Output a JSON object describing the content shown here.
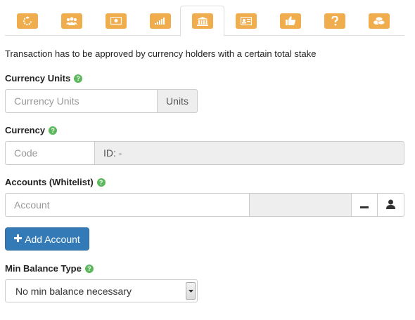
{
  "tabs": [
    {
      "icon": "refresh-icon"
    },
    {
      "icon": "users-icon"
    },
    {
      "icon": "money-icon"
    },
    {
      "icon": "signal-icon"
    },
    {
      "icon": "bank-icon",
      "active": true
    },
    {
      "icon": "id-card-icon"
    },
    {
      "icon": "thumbs-up-icon"
    },
    {
      "icon": "question-icon"
    },
    {
      "icon": "coins-icon"
    }
  ],
  "colors": {
    "tab_icon": "#f0ad4e",
    "help_icon": "#5cb85c",
    "primary": "#337ab7"
  },
  "description": "Transaction has to be approved by currency holders with a certain total stake",
  "currency_units": {
    "label": "Currency Units",
    "placeholder": "Currency Units",
    "addon": "Units"
  },
  "currency": {
    "label": "Currency",
    "code_placeholder": "Code",
    "id_text": "ID: -"
  },
  "accounts": {
    "label": "Accounts (Whitelist)",
    "placeholder": "Account",
    "remove_icon": "minus-icon",
    "user_icon": "user-icon"
  },
  "add_account": {
    "icon": "plus-icon",
    "label": "Add Account"
  },
  "min_balance": {
    "label": "Min Balance Type",
    "selected": "No min balance necessary"
  }
}
